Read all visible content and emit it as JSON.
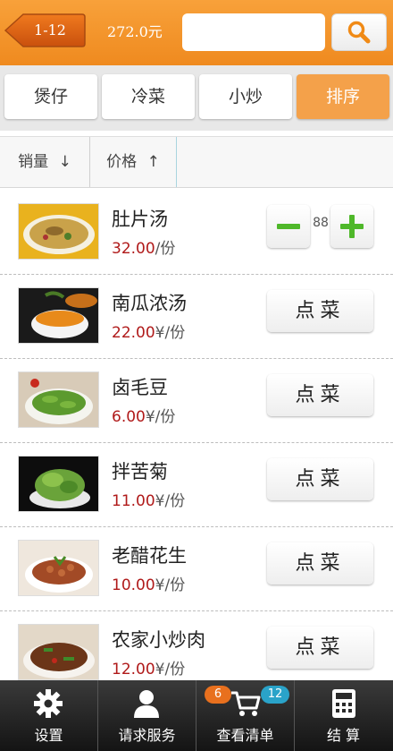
{
  "header": {
    "table_no": "1-12",
    "total": "272.0元",
    "search_placeholder": ""
  },
  "categories": [
    "煲仔",
    "冷菜",
    "小炒",
    "排序"
  ],
  "active_category": "排序",
  "sort": {
    "sales_label": "销量",
    "sales_arrow": "↓",
    "price_label": "价格",
    "price_arrow": "↑"
  },
  "dishes": [
    {
      "name": "肚片汤",
      "price": "32.00",
      "unit": "/份",
      "quantity": "88"
    },
    {
      "name": "南瓜浓汤",
      "price": "22.00",
      "unit": "¥/份",
      "button": "点菜"
    },
    {
      "name": "卤毛豆",
      "price": "6.00",
      "unit": "¥/份",
      "button": "点菜"
    },
    {
      "name": "拌苦菊",
      "price": "11.00",
      "unit": "¥/份",
      "button": "点菜"
    },
    {
      "name": "老醋花生",
      "price": "10.00",
      "unit": "¥/份",
      "button": "点菜"
    },
    {
      "name": "农家小炒肉",
      "price": "12.00",
      "unit": "¥/份",
      "button": "点菜"
    }
  ],
  "bottom_tabs": [
    {
      "label": "设置",
      "icon": "gear-icon"
    },
    {
      "label": "请求服务",
      "icon": "person-icon"
    },
    {
      "label": "查看清单",
      "icon": "cart-icon"
    },
    {
      "label": "结 算",
      "icon": "calculator-icon"
    }
  ],
  "cart_badges": {
    "left": "6",
    "right": "12"
  },
  "colors": {
    "accent": "#f39323",
    "price": "#b01a1a",
    "plus": "#4fb82a"
  }
}
